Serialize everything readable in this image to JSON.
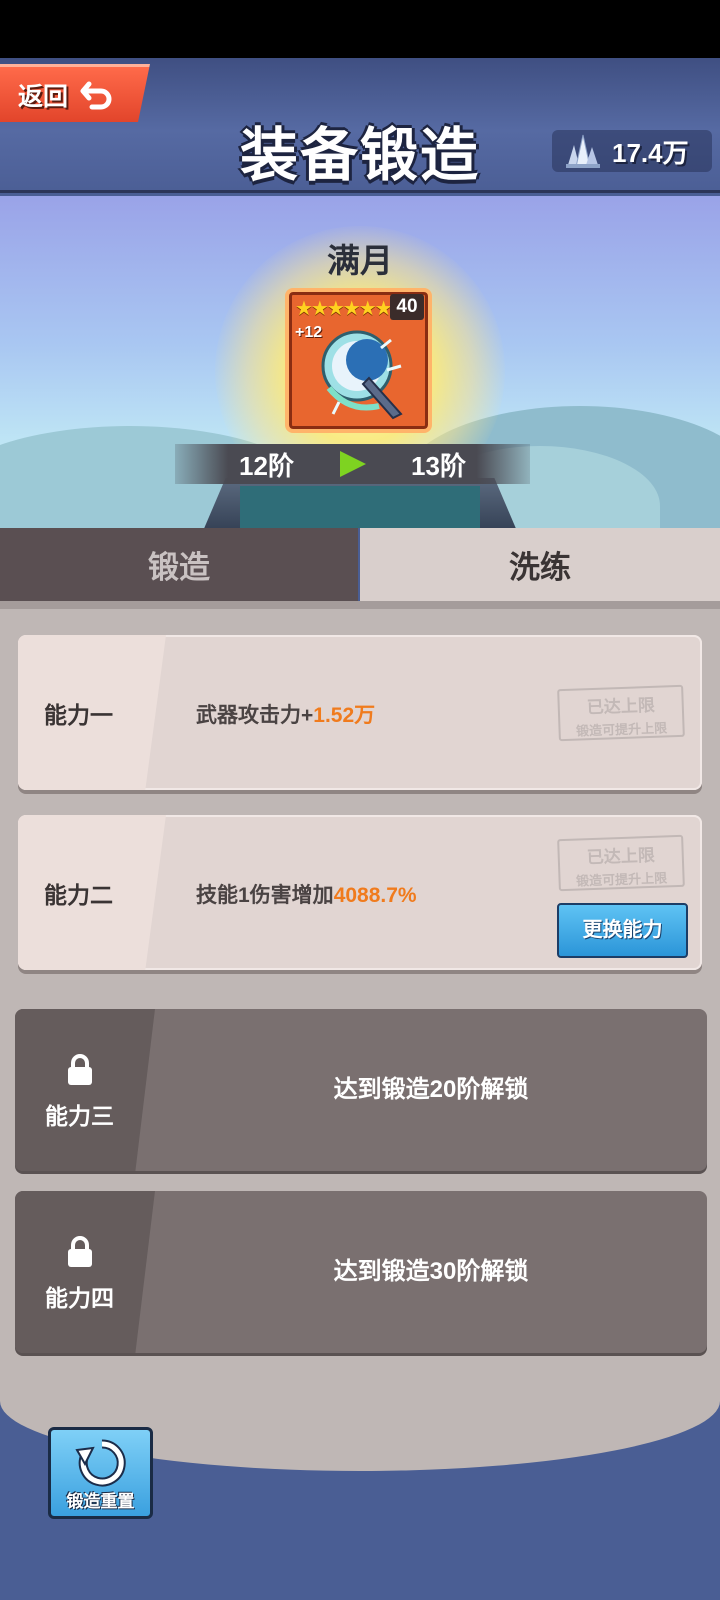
{
  "header": {
    "back_label": "返回",
    "title": "装备锻造",
    "currency_value": "17.4万"
  },
  "item": {
    "name": "满月",
    "stars": "★★★★★★",
    "level": "40",
    "enhance": "+12",
    "stage_from": "12阶",
    "stage_to": "13阶"
  },
  "tabs": [
    {
      "label": "锻造",
      "selected": false
    },
    {
      "label": "洗练",
      "selected": true
    }
  ],
  "abilities": [
    {
      "name": "能力一",
      "text": "武器攻击力+",
      "value": "1.52万",
      "stamp_line1": "已达上限",
      "stamp_line2": "锻造可提升上限"
    },
    {
      "name": "能力二",
      "text": "技能1伤害增加",
      "value": "4088.7%",
      "stamp_line1": "已达上限",
      "stamp_line2": "锻造可提升上限",
      "button": "更换能力"
    }
  ],
  "locked": [
    {
      "name": "能力三",
      "text": "达到锻造20阶解锁"
    },
    {
      "name": "能力四",
      "text": "达到锻造30阶解锁"
    }
  ],
  "reset_label": "锻造重置",
  "colors": {
    "accent_orange": "#f07b1d",
    "button_blue": "#2b95d8",
    "back_red": "#e2452b"
  }
}
